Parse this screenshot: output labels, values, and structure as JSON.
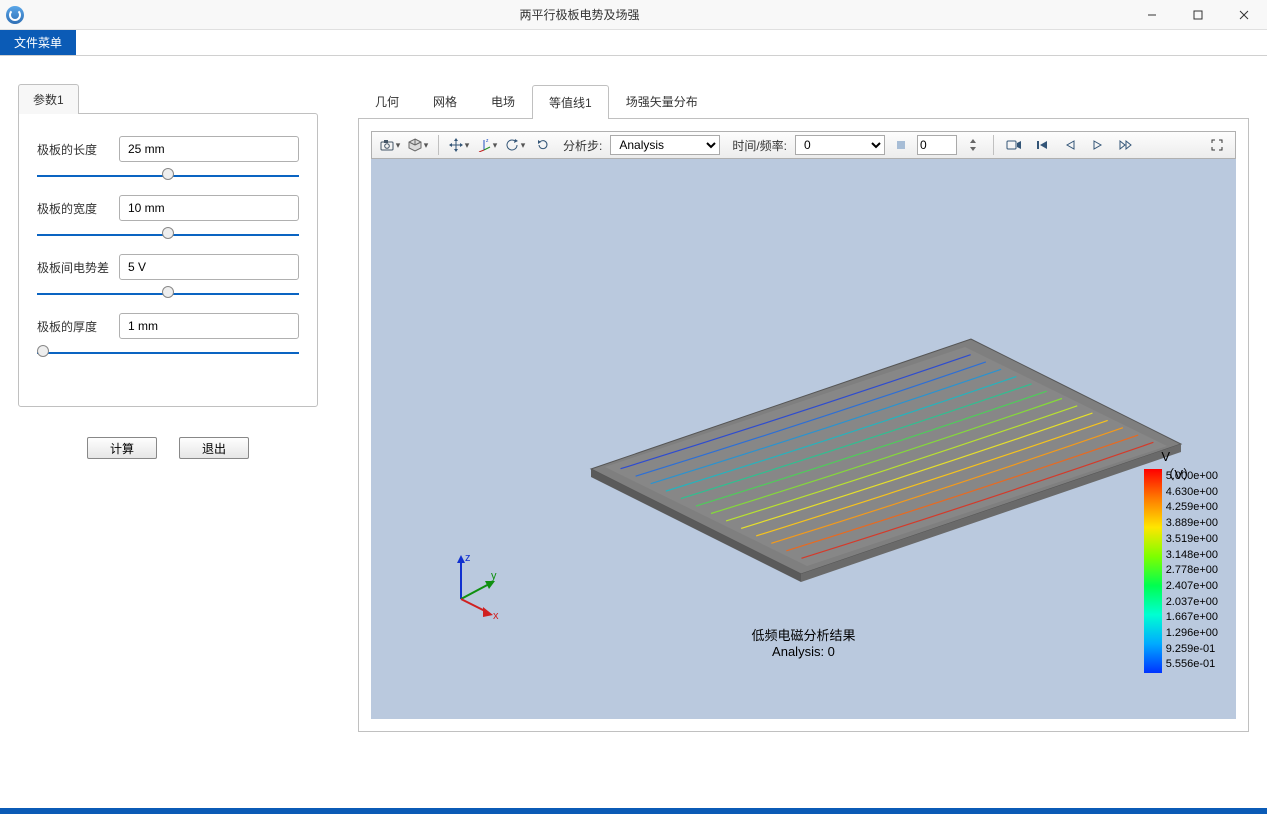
{
  "window": {
    "title": "两平行极板电势及场强"
  },
  "menubar": {
    "file": "文件菜单"
  },
  "left_panel": {
    "tab": "参数1",
    "params": [
      {
        "label": "极板的长度",
        "value": "25 mm",
        "slider": 50
      },
      {
        "label": "极板的宽度",
        "value": "10 mm",
        "slider": 50
      },
      {
        "label": "极板间电势差",
        "value": "5 V",
        "slider": 50
      },
      {
        "label": "极板的厚度",
        "value": "1 mm",
        "slider": 0
      }
    ],
    "actions": {
      "compute": "计算",
      "exit": "退出"
    }
  },
  "view_tabs": {
    "items": [
      "几何",
      "网格",
      "电场",
      "等值线1",
      "场强矢量分布"
    ],
    "active_index": 3
  },
  "toolbar": {
    "analysis_step_label": "分析步:",
    "analysis_combo": "Analysis",
    "time_freq_label": "时间/频率:",
    "time_freq_value": "0",
    "frame_value": "0"
  },
  "viewport": {
    "legend_title": "V\n（V）",
    "legend_values": [
      "5.000e+00",
      "4.630e+00",
      "4.259e+00",
      "3.889e+00",
      "3.519e+00",
      "3.148e+00",
      "2.778e+00",
      "2.407e+00",
      "2.037e+00",
      "1.667e+00",
      "1.296e+00",
      "9.259e-01",
      "5.556e-01"
    ],
    "caption_line1": "低频电磁分析结果",
    "caption_line2": "Analysis: 0",
    "axes": {
      "x": "x",
      "y": "y",
      "z": "z"
    }
  },
  "contour_colors": [
    "#d43a2a",
    "#e96a1f",
    "#f49a1a",
    "#f7c31c",
    "#e7e02a",
    "#b9e22f",
    "#84d93a",
    "#4fcc5a",
    "#2fc090",
    "#26b3bd",
    "#2a93d0",
    "#2d6fd6",
    "#2e4cd0"
  ]
}
